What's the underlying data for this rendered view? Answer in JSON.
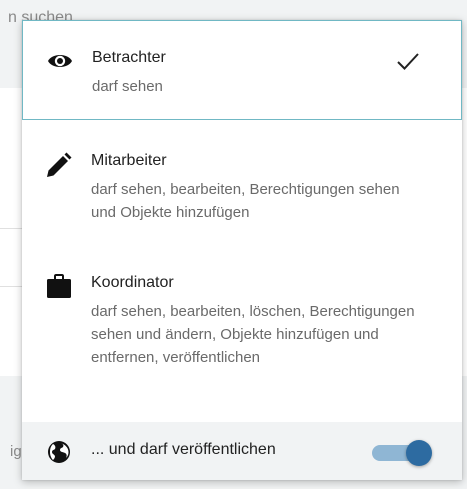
{
  "background": {
    "search_placeholder": "n suchen",
    "footer_fragment": "ig"
  },
  "menu": {
    "options": [
      {
        "icon": "eye-icon",
        "title": "Betrachter",
        "description": "darf sehen",
        "selected": true
      },
      {
        "icon": "pencil-icon",
        "title": "Mitarbeiter",
        "description": "darf sehen, bearbeiten, Berechtigungen sehen und Objekte hinzufügen",
        "selected": false
      },
      {
        "icon": "briefcase-icon",
        "title": "Koordinator",
        "description": "darf sehen, bearbeiten, löschen, Berechtigungen sehen und ändern, Objekte hinzufügen und entfernen, veröffentlichen",
        "selected": false
      }
    ],
    "selected_mark": "checkmark-icon",
    "publish": {
      "icon": "globe-icon",
      "label": "... und darf veröffentlichen",
      "enabled": true
    }
  },
  "colors": {
    "accent": "#2d6ba1",
    "toggle_track": "#8fb6d4",
    "selected_border": "#70b8c4",
    "footer_bg": "#f1f3f4"
  }
}
